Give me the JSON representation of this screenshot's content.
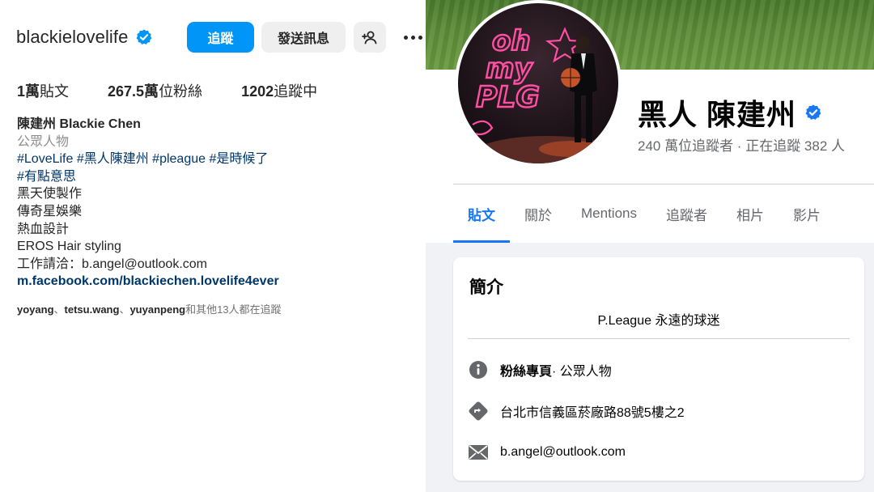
{
  "instagram": {
    "username": "blackielovelife",
    "follow_label": "追蹤",
    "message_label": "發送訊息",
    "stats": {
      "posts_count": "1萬",
      "posts_label": "貼文",
      "followers_count": "267.5萬",
      "followers_label": "位粉絲",
      "following_count": "1202",
      "following_label": "追蹤中"
    },
    "bio": {
      "name": "陳建州 Blackie Chen",
      "category": "公眾人物",
      "line1": "#LoveLife #黑人陳建州 #pleague #是時候了",
      "line2": "#有點意思",
      "line3": "黑天使製作",
      "line4": "傳奇星娛樂",
      "line5": "熱血設計",
      "line6": "EROS Hair styling",
      "line7": "工作請洽：b.angel@outlook.com",
      "link": "m.facebook.com/blackiechen.lovelife4ever"
    },
    "followed_by": {
      "user1": "yoyang",
      "sep1": "、",
      "user2": "tetsu.wang",
      "sep2": "、",
      "user3": "yuyanpeng",
      "rest": "和其他13人都在追蹤"
    }
  },
  "facebook": {
    "page_name": "黑人 陳建州",
    "followers_line": "240 萬位追蹤者 · 正在追蹤 382 人",
    "tabs": [
      "貼文",
      "關於",
      "Mentions",
      "追蹤者",
      "相片",
      "影片"
    ],
    "active_tab": "貼文",
    "intro": {
      "title": "簡介",
      "description": "P.League 永遠的球迷",
      "page_type_bold": "粉絲專頁",
      "page_type_rest": " · 公眾人物",
      "address": "台北市信義區菸廠路88號5樓之2",
      "email": "b.angel@outlook.com"
    },
    "avatar_text": {
      "oh": "oh",
      "my": "my",
      "plg": "PLG"
    }
  },
  "colors": {
    "ig_blue": "#0095f6",
    "ig_link": "#00376b",
    "fb_blue": "#1877f2",
    "fb_gray_text": "#65676b",
    "neon_pink": "#ff4fa3"
  },
  "icons": {
    "ig_verified": "verified-badge-icon",
    "ig_add_person": "add-person-icon",
    "ig_more": "more-dots-icon",
    "fb_verified": "verified-badge-icon",
    "fb_info": "info-icon",
    "fb_direction": "direction-diamond-icon",
    "fb_mail": "mail-icon"
  }
}
